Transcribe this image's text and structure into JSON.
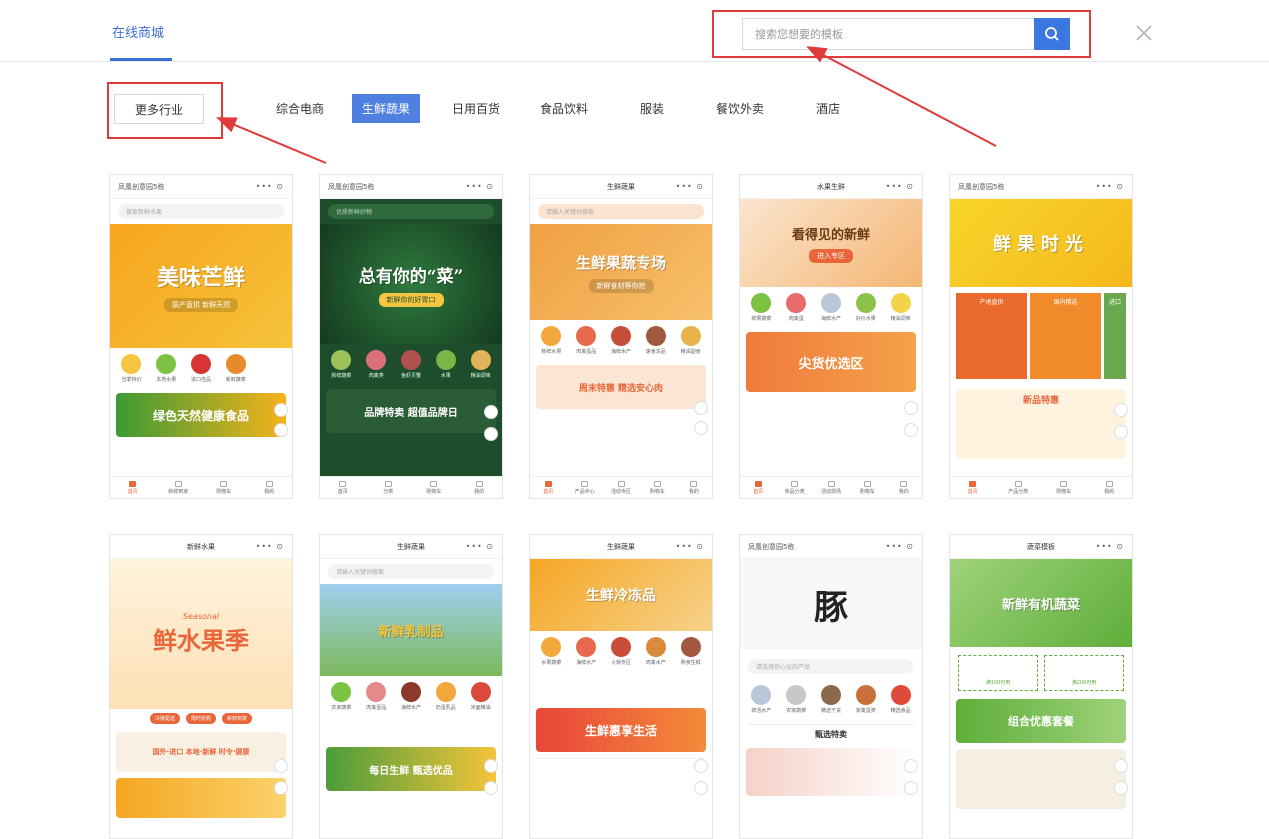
{
  "nav": {
    "tab_label": "在线商城"
  },
  "search": {
    "placeholder": "搜索您想要的模板"
  },
  "filters": {
    "more_label": "更多行业",
    "categories": [
      "综合电商",
      "生鲜蔬果",
      "日用百货",
      "食品饮料",
      "服装",
      "餐饮外卖",
      "酒店"
    ],
    "active": "生鲜蔬果"
  },
  "colors": {
    "accent": "#3a78e0",
    "active_category": "#4f7fe0",
    "annotation": "#e03a3a"
  },
  "templates": [
    {
      "header": "凤凰创意园5栋",
      "search": "搜索新鲜水果",
      "banner": "美味芒鲜",
      "banner_sub": "原产直供 新鲜天然",
      "icons": [
        "当季特价",
        "本地水果",
        "进口佳品",
        "新鲜蔬菜",
        "—"
      ],
      "promo": "绿色天然健康食品",
      "nav": [
        "首页",
        "新鲜到家",
        "购物车",
        "我的"
      ]
    },
    {
      "header": "凤凰创意园5栋",
      "search": "优质新鲜好物",
      "banner": "总有你的“菜”",
      "banner_sub": "新鲜你的好胃口",
      "icons": [
        "新鲜蔬菜",
        "肉禽类",
        "鱼虾贝蟹",
        "水果",
        "粮油调味"
      ],
      "promo": "品牌特卖 超值品牌日",
      "nav": [
        "首页",
        "分类",
        "购物车",
        "我的"
      ]
    },
    {
      "header": "生鲜蔬果",
      "search": "请输入关键词搜索",
      "banner": "生鲜果蔬专场",
      "banner_sub": "新鲜食材等你抢",
      "icons": [
        "新鲜水果",
        "肉禽蛋品",
        "海鲜水产",
        "速食冻品",
        "粮油副食"
      ],
      "promo": "周末特惠 精选安心肉",
      "nav": [
        "首页",
        "产品中心",
        "活动专区",
        "购物车",
        "我的"
      ]
    },
    {
      "header": "水果生鲜",
      "search": "",
      "banner": "看得见的新鲜",
      "banner_sub": "进入专区",
      "icons": [
        "鲜果蔬菜",
        "肉禽蛋",
        "海鲜水产",
        "好价水果",
        "粮油调味"
      ],
      "promo": "尖货优选区",
      "nav": [
        "首页",
        "商品分类",
        "活动现场",
        "购物车",
        "我的"
      ]
    },
    {
      "header": "凤凰创意园5栋",
      "search": "",
      "banner": "鲜果时光",
      "banner_sub": "",
      "icons": [
        "产地直供",
        "国内精选",
        "进口",
        "—",
        "—"
      ],
      "promo": "新品特惠",
      "nav": [
        "首页",
        "产品分类",
        "购物车",
        "我的"
      ]
    },
    {
      "header": "新鲜水果",
      "search": "",
      "banner": "鲜水果季",
      "banner_sub": "Seasonal",
      "icons": [
        "冷链配送",
        "限时抢购",
        "新鲜到家",
        "—",
        "—"
      ],
      "promo": "国外·进口  本地·新鲜  时令·健康",
      "nav": []
    },
    {
      "header": "生鲜蔬果",
      "search": "请输入关键词搜索",
      "banner": "新鲜乳制品",
      "banner_sub": "",
      "icons": [
        "农家蔬菜",
        "肉禽蛋品",
        "海鲜水产",
        "奶蛋乳品",
        "米面粮油"
      ],
      "promo": "每日生鲜 甄选优品",
      "nav": []
    },
    {
      "header": "生鲜蔬果",
      "search": "",
      "banner": "生鲜冷冻品",
      "banner_sub": "",
      "icons": [
        "水果蔬菜",
        "海鲜水产",
        "火锅专区",
        "肉禽水产",
        "熟食生鲜"
      ],
      "promo": "生鲜惠享生活",
      "nav": []
    },
    {
      "header": "凤凰创意园5栋",
      "search": "请选择你心仪的产品",
      "banner": "豚",
      "banner_sub": "",
      "icons": [
        "鲜活水产",
        "农家蔬菜",
        "精选干货",
        "家禽蛋类",
        "精选食品"
      ],
      "promo": "甄选特卖",
      "nav": []
    },
    {
      "header": "蔬菜模板",
      "search": "",
      "banner": "新鲜有机蔬菜",
      "banner_sub": "",
      "icons": [
        "满100可用",
        "满200可用",
        "—",
        "—",
        "—"
      ],
      "promo": "组合优惠套餐",
      "nav": []
    }
  ]
}
